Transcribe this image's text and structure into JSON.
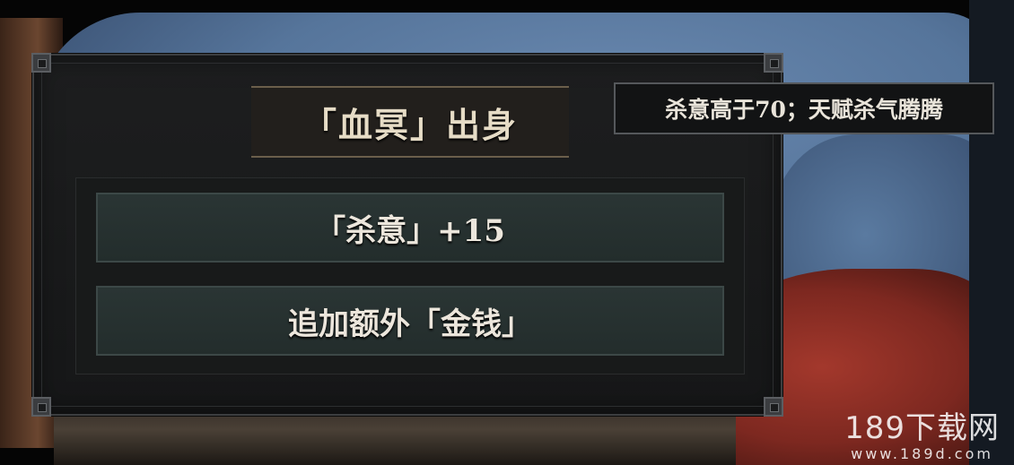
{
  "event_card": {
    "title": "「血冥」出身",
    "options": [
      {
        "label": "「杀意」+15"
      },
      {
        "label": "追加额外「金钱」"
      }
    ]
  },
  "tooltip": {
    "text": "杀意高于70；天赋杀气腾腾"
  },
  "watermark": {
    "brand": "189下载网",
    "url": "www.189d.com"
  },
  "colors": {
    "panel_bg": "#1d1e1f",
    "option_bg": "#2a3534",
    "title_text": "#e6dcc6",
    "title_border": "#6b5e4b",
    "cloth_blue": "#56759b",
    "cloth_red": "#7d2820"
  }
}
